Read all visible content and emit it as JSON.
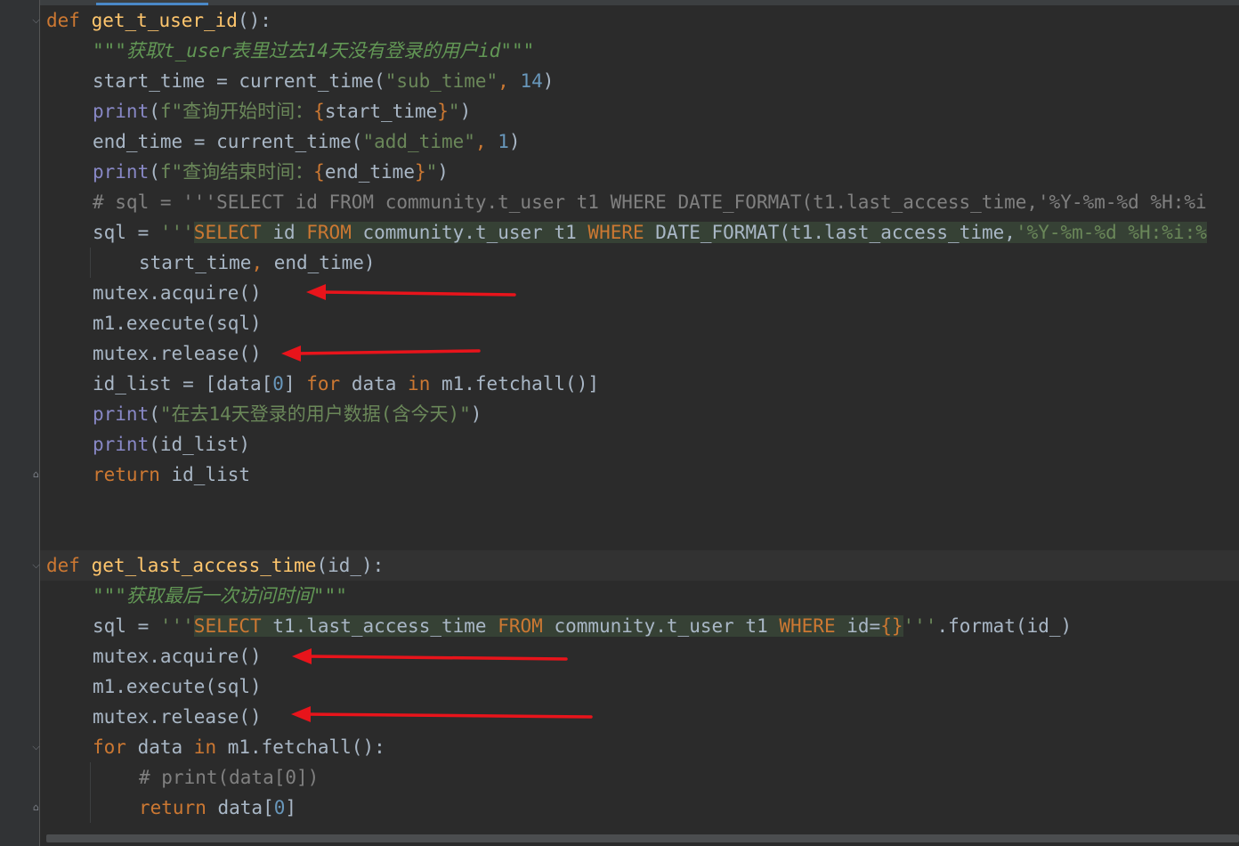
{
  "editor": {
    "language": "python",
    "annotation_color": "#e8141b",
    "lines": [
      "def get_t_user_id():",
      "\"\"\"获取t_user表里过去14天没有登录的用户id\"\"\"",
      "start_time = current_time(\"sub_time\", 14)",
      "print(f\"查询开始时间：{start_time}\")",
      "end_time = current_time(\"add_time\", 1)",
      "print(f\"查询结束时间：{end_time}\")",
      "# sql = '''SELECT id FROM community.t_user t1 WHERE DATE_FORMAT(t1.last_access_time,'%Y-%m-%d %H:%i",
      "sql = '''SELECT id FROM community.t_user t1 WHERE DATE_FORMAT(t1.last_access_time,'%Y-%m-%d %H:%i:%",
      "start_time, end_time)",
      "mutex.acquire()",
      "m1.execute(sql)",
      "mutex.release()",
      "id_list = [data[0] for data in m1.fetchall()]",
      "print(\"在去14天登录的用户数据(含今天)\")",
      "print(id_list)",
      "return id_list",
      "",
      "",
      "def get_last_access_time(id_):",
      "\"\"\"获取最后一次访问时间\"\"\"",
      "sql = '''SELECT t1.last_access_time FROM community.t_user t1 WHERE id={}'''.format(id_)",
      "mutex.acquire()",
      "m1.execute(sql)",
      "mutex.release()",
      "for data in m1.fetchall():",
      "# print(data[0])",
      "return data[0]"
    ]
  }
}
